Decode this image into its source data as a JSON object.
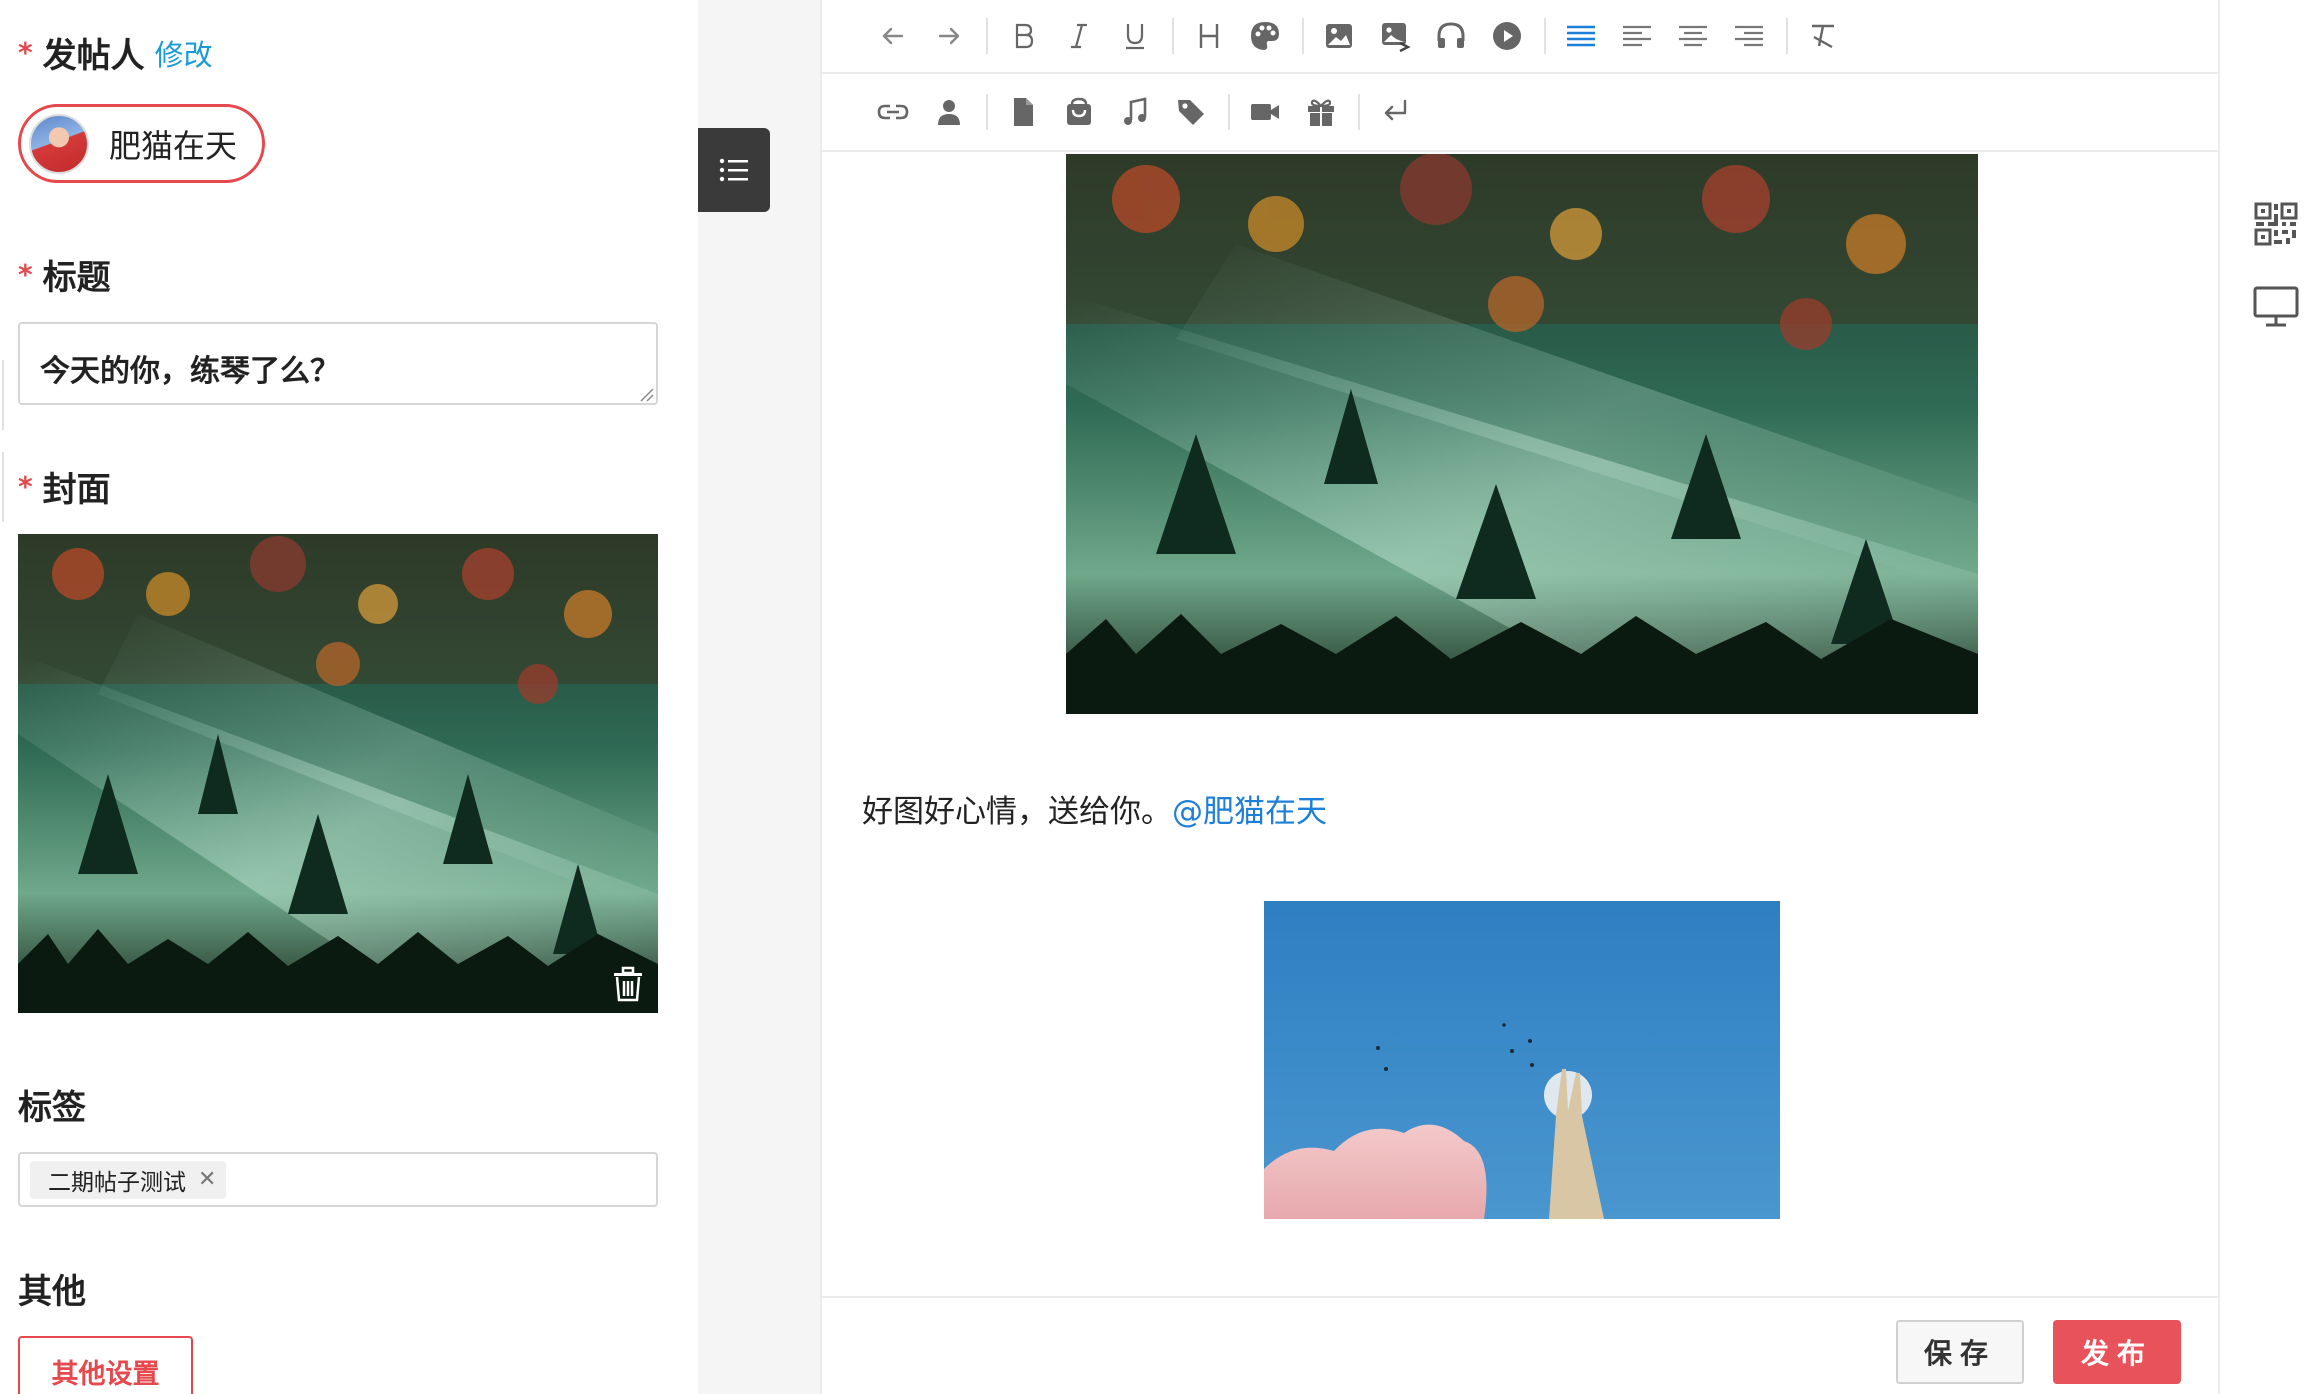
{
  "form": {
    "poster_label": "发帖人",
    "poster_edit": "修改",
    "poster_name": "肥猫在天",
    "title_label": "标题",
    "title_value": "今天的你，练琴了么？",
    "cover_label": "封面",
    "tags_label": "标签",
    "tags": [
      "二期帖子测试"
    ],
    "other_label": "其他",
    "other_button": "其他设置",
    "required_mark": "*"
  },
  "editor": {
    "toolbar_row1": [
      "undo-icon",
      "redo-icon",
      "|",
      "bold-icon",
      "italic-icon",
      "underline-icon",
      "|",
      "heading-icon",
      "palette-icon",
      "|",
      "image-icon",
      "image-upload-icon",
      "audio-icon",
      "video-play-icon",
      "|",
      "align-justify-icon",
      "align-left-icon",
      "align-center-icon",
      "align-right-icon",
      "|",
      "clear-format-icon"
    ],
    "toolbar_row2": [
      "link-icon",
      "user-icon",
      "|",
      "file-icon",
      "shopping-bag-icon",
      "music-icon",
      "tag-icon",
      "|",
      "video-camera-icon",
      "gift-icon",
      "|",
      "line-break-icon"
    ],
    "paragraph_text": "好图好心情，送给你。",
    "mention": "@肥猫在天",
    "save_label": "保存",
    "publish_label": "发布",
    "accent_color": "#1e7fd8"
  },
  "colors": {
    "required": "#e5484d",
    "publish": "#e8525a",
    "link": "#1a9bd8"
  }
}
